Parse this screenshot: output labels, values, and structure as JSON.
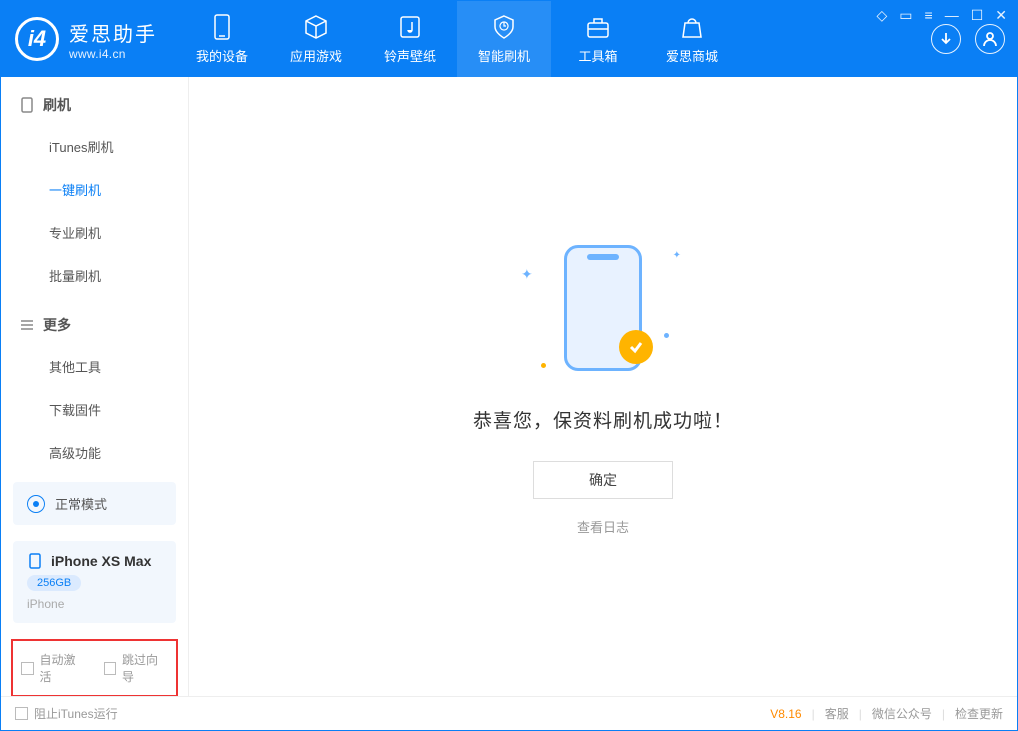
{
  "app": {
    "name_cn": "爱思助手",
    "url": "www.i4.cn"
  },
  "nav": {
    "tabs": [
      {
        "label": "我的设备",
        "icon": "device"
      },
      {
        "label": "应用游戏",
        "icon": "cube"
      },
      {
        "label": "铃声壁纸",
        "icon": "music"
      },
      {
        "label": "智能刷机",
        "icon": "shield",
        "active": true
      },
      {
        "label": "工具箱",
        "icon": "toolbox"
      },
      {
        "label": "爱思商城",
        "icon": "store"
      }
    ]
  },
  "sidebar": {
    "section1": {
      "title": "刷机",
      "items": [
        "iTunes刷机",
        "一键刷机",
        "专业刷机",
        "批量刷机"
      ],
      "activeIndex": 1
    },
    "section2": {
      "title": "更多",
      "items": [
        "其他工具",
        "下载固件",
        "高级功能"
      ]
    },
    "mode": {
      "label": "正常模式"
    },
    "device": {
      "name": "iPhone XS Max",
      "storage": "256GB",
      "type": "iPhone"
    },
    "checks": {
      "auto_activate": "自动激活",
      "skip_wizard": "跳过向导"
    }
  },
  "main": {
    "success_text": "恭喜您，保资料刷机成功啦！",
    "ok_label": "确定",
    "log_link": "查看日志"
  },
  "footer": {
    "block_itunes": "阻止iTunes运行",
    "version": "V8.16",
    "links": [
      "客服",
      "微信公众号",
      "检查更新"
    ]
  },
  "colors": {
    "primary": "#0a7ff5",
    "accent_orange": "#ffb400",
    "highlight_red": "#e33"
  }
}
